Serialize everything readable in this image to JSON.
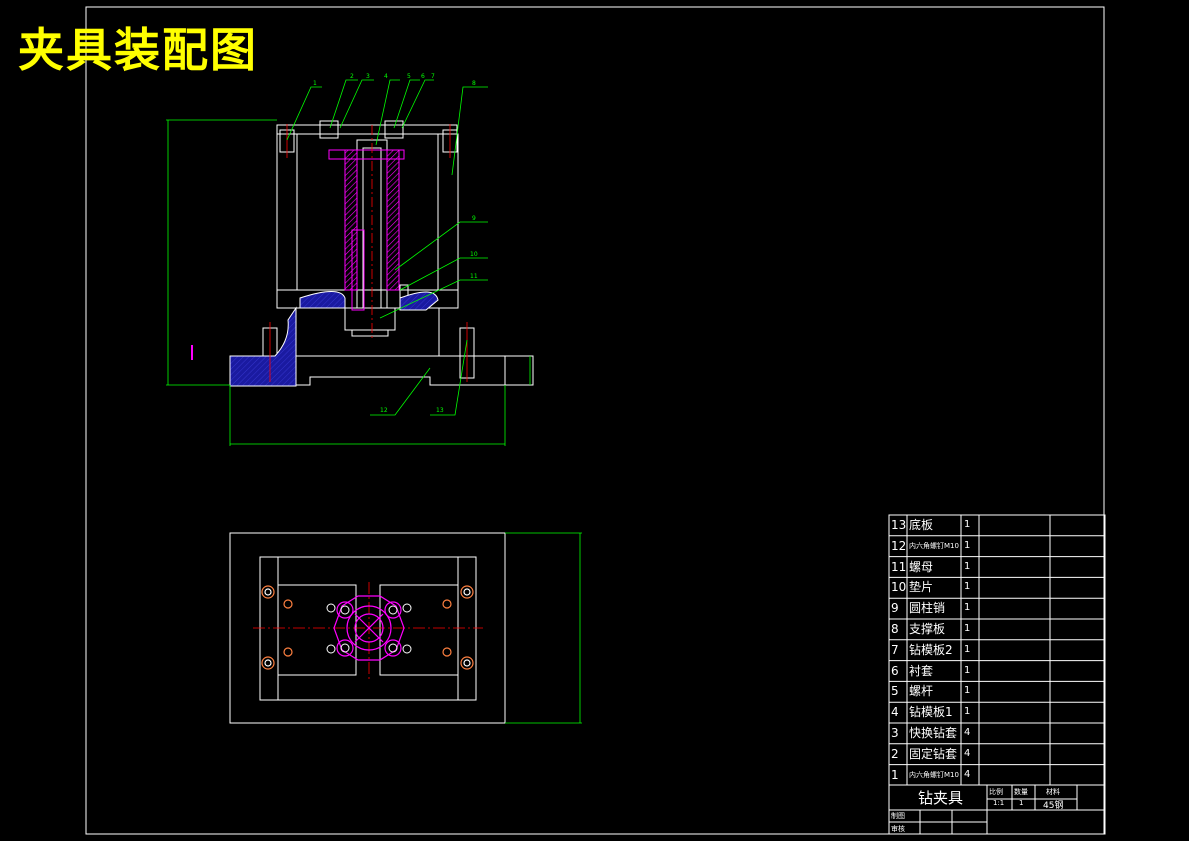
{
  "title": "夹具装配图",
  "colors": {
    "background": "#000000",
    "title": "#ffff00",
    "outline": "#ffffff",
    "dimension": "#00ff00",
    "centerline": "#ff0000",
    "bushing": "#ff00ff",
    "hatch_blue": "#1a1aa0"
  },
  "leader_numbers": [
    "1",
    "2",
    "3",
    "4",
    "5",
    "6",
    "7",
    "8",
    "9",
    "10",
    "11",
    "12",
    "13"
  ],
  "bom": {
    "rows": [
      {
        "no": "13",
        "name": "底板",
        "qty": "1"
      },
      {
        "no": "12",
        "name": "内六角螺钉M10",
        "qty": "1"
      },
      {
        "no": "11",
        "name": "螺母",
        "qty": "1"
      },
      {
        "no": "10",
        "name": "垫片",
        "qty": "1"
      },
      {
        "no": "9",
        "name": "圆柱销",
        "qty": "1"
      },
      {
        "no": "8",
        "name": "支撑板",
        "qty": "1"
      },
      {
        "no": "7",
        "name": "钻模板2",
        "qty": "1"
      },
      {
        "no": "6",
        "name": "衬套",
        "qty": "1"
      },
      {
        "no": "5",
        "name": "螺杆",
        "qty": "1"
      },
      {
        "no": "4",
        "name": "钻模板1",
        "qty": "1"
      },
      {
        "no": "3",
        "name": "快换钻套",
        "qty": "4"
      },
      {
        "no": "2",
        "name": "固定钻套",
        "qty": "4"
      },
      {
        "no": "1",
        "name": "内六角螺钉M10",
        "qty": "4"
      }
    ]
  },
  "title_block": {
    "name": "钻夹具",
    "scale_label": "比例",
    "qty_label": "数量",
    "material_label": "材料",
    "scale": "1:1",
    "qty": "1",
    "material": "45钢",
    "drawn_label": "制图",
    "checked_label": "审核"
  }
}
